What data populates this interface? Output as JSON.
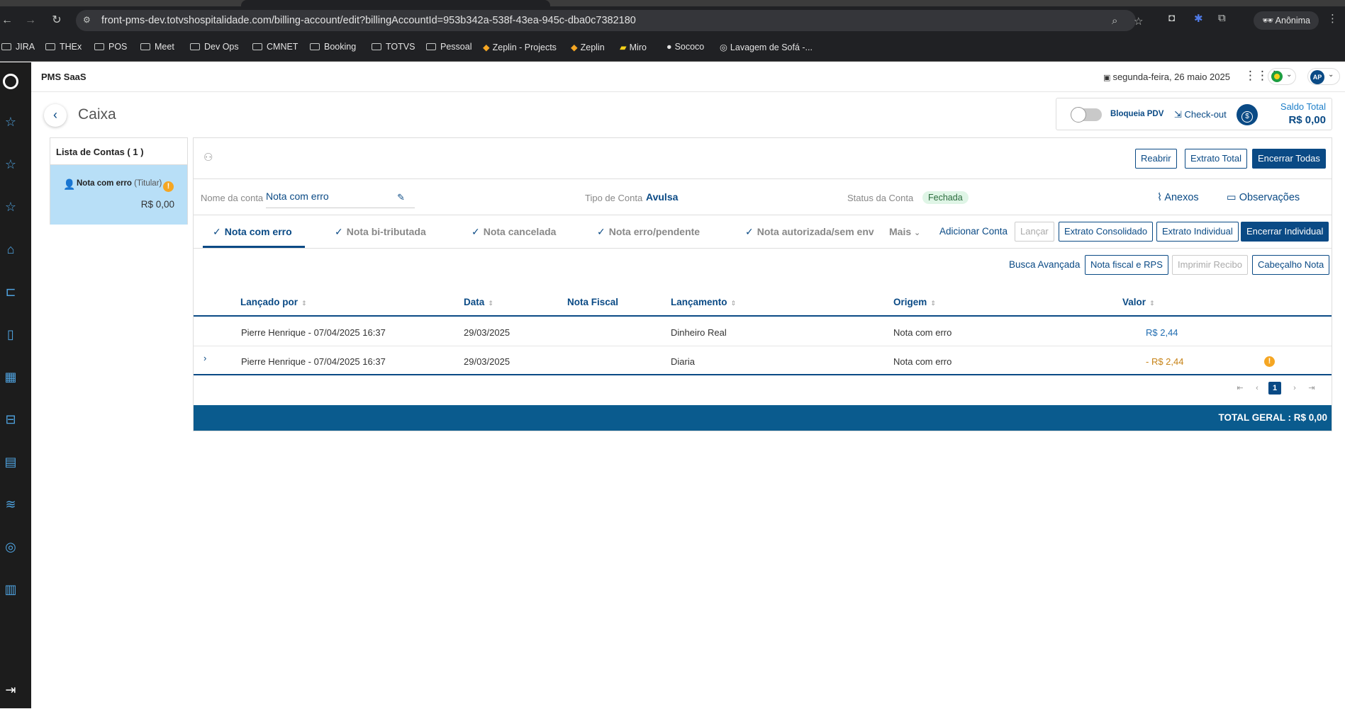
{
  "browser": {
    "url": "front-pms-dev.totvshospitalidade.com/billing-account/edit?billingAccountId=953b342a-538f-43ea-945c-dba0c7382180",
    "profile_label": "Anônima",
    "bookmarks": [
      "JIRA",
      "THEx",
      "POS",
      "Meet",
      "Dev Ops",
      "CMNET",
      "Booking",
      "TOTVS",
      "Pessoal",
      "Zeplin - Projects",
      "Zeplin",
      "Miro",
      "Sococo",
      "Lavagem de Sofá -..."
    ]
  },
  "app": {
    "title": "PMS SaaS",
    "date": "segunda-feira, 26 maio 2025",
    "avatar_initials": "AP"
  },
  "page": {
    "title": "Caixa",
    "bloqueia_pdv": "Bloqueia PDV",
    "checkout": "Check-out",
    "saldo_label": "Saldo Total",
    "saldo_value": "R$ 0,00"
  },
  "accounts": {
    "header": "Lista de Contas ( 1 )",
    "items": [
      {
        "name": "Nota com erro",
        "role": "(Titular)",
        "value": "R$ 0,00"
      }
    ]
  },
  "toolbar": {
    "reabrir": "Reabrir",
    "extrato_total": "Extrato Total",
    "encerrar_todas": "Encerrar Todas"
  },
  "account_info": {
    "name_label": "Nome da conta",
    "name_value": "Nota com erro",
    "type_label": "Tipo de Conta",
    "type_value": "Avulsa",
    "status_label": "Status da Conta",
    "status_value": "Fechada",
    "anexos": "Anexos",
    "observacoes": "Observações"
  },
  "tabs": [
    {
      "label": "Nota com erro",
      "active": true
    },
    {
      "label": "Nota bi-tributada",
      "active": false
    },
    {
      "label": "Nota cancelada",
      "active": false
    },
    {
      "label": "Nota erro/pendente",
      "active": false
    },
    {
      "label": "Nota autorizada/sem env",
      "active": false
    }
  ],
  "tab_actions": {
    "mais": "Mais",
    "adicionar_conta": "Adicionar Conta",
    "lancar": "Lançar",
    "extrato_consolidado": "Extrato Consolidado",
    "extrato_individual": "Extrato Individual",
    "encerrar_individual": "Encerrar Individual"
  },
  "row_actions": {
    "busca_avancada": "Busca Avançada",
    "nota_fiscal_rps": "Nota fiscal e RPS",
    "imprimir_recibo": "Imprimir Recibo",
    "cabecalho_nota": "Cabeçalho Nota"
  },
  "table": {
    "columns": [
      "Lançado por",
      "Data",
      "Nota Fiscal",
      "Lançamento",
      "Origem",
      "Valor"
    ],
    "rows": [
      {
        "lancado_por": "Pierre Henrique - 07/04/2025 16:37",
        "data": "29/03/2025",
        "nota_fiscal": "",
        "lancamento": "Dinheiro Real",
        "origem": "Nota com erro",
        "valor": "R$ 2,44"
      },
      {
        "lancado_por": "Pierre Henrique - 07/04/2025 16:37",
        "data": "29/03/2025",
        "nota_fiscal": "",
        "lancamento": "Diaria",
        "origem": "Nota com erro",
        "valor": "- R$ 2,44"
      }
    ]
  },
  "pagination": {
    "current_page": "1"
  },
  "total": "TOTAL GERAL : R$ 0,00",
  "colors": {
    "primary": "#0a4a85",
    "selected": "#b8dff7",
    "warning": "#f5a623",
    "total_bar": "#0a5b8e"
  }
}
